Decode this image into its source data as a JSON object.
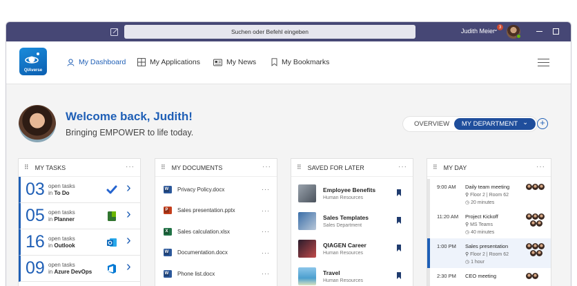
{
  "titlebar": {
    "search_placeholder": "Suchen oder Befehl eingeben",
    "user_name": "Judith Meier",
    "notification_count": "3",
    "caret": "⌄"
  },
  "nav": {
    "logo_text": "QIAverse",
    "items": [
      {
        "label": "My Dashboard",
        "icon": "person-icon",
        "active": true
      },
      {
        "label": "My Applications",
        "icon": "apps-grid-icon",
        "active": false
      },
      {
        "label": "My News",
        "icon": "news-icon",
        "active": false
      },
      {
        "label": "My Bookmarks",
        "icon": "bookmark-icon",
        "active": false
      }
    ]
  },
  "welcome": {
    "title": "Welcome back, Judith!",
    "subtitle": "Bringing EMPOWER to life today."
  },
  "view_switch": {
    "overview": "OVERVIEW",
    "department": "MY DEPARTMENT",
    "department_caret": "⌄",
    "plus": "+"
  },
  "tasks": {
    "title": "MY TASKS",
    "menu": "···",
    "prefix": "open tasks",
    "rows": [
      {
        "count": "03",
        "in": "in",
        "app": "To Do",
        "icon": "todo-check-icon",
        "color": "#2564cf"
      },
      {
        "count": "05",
        "in": "in",
        "app": "Planner",
        "icon": "planner-icon",
        "color": "#31752f"
      },
      {
        "count": "16",
        "in": "in",
        "app": "Outlook",
        "icon": "outlook-icon",
        "color": "#0f6cbd"
      },
      {
        "count": "09",
        "in": "in",
        "app": "Azure DevOps",
        "icon": "azure-devops-icon",
        "color": "#0078d4"
      }
    ]
  },
  "documents": {
    "title": "MY DOCUMENTS",
    "menu": "···",
    "rows": [
      {
        "name": "Privacy Policy.docx",
        "type": "word",
        "letter": "W",
        "color": "#2b579a"
      },
      {
        "name": "Sales presentation.pptx",
        "type": "powerpoint",
        "letter": "P",
        "color": "#c43e1c"
      },
      {
        "name": "Sales calculation.xlsx",
        "type": "excel",
        "letter": "X",
        "color": "#217346"
      },
      {
        "name": "Documentation.docx",
        "type": "word",
        "letter": "W",
        "color": "#2b579a"
      },
      {
        "name": "Phone list.docx",
        "type": "word",
        "letter": "W",
        "color": "#2b579a"
      }
    ],
    "row_menu": "···"
  },
  "saved": {
    "title": "SAVED FOR LATER",
    "menu": "···",
    "rows": [
      {
        "title": "Employee Benefits",
        "sub": "Human Resources",
        "thumb": "linear-gradient(135deg,#9aa3ad,#4a525c)"
      },
      {
        "title": "Sales Templates",
        "sub": "Sales Department",
        "thumb": "linear-gradient(135deg,#3a6ea8,#b8c7d8)"
      },
      {
        "title": "QIAGEN Career",
        "sub": "Human Resources",
        "thumb": "linear-gradient(135deg,#2a1c2c,#c04a4a)"
      },
      {
        "title": "Travel",
        "sub": "Human Resources",
        "thumb": "linear-gradient(180deg,#8cc6ea,#4c9fcf 60%,#d8e3c0)"
      }
    ]
  },
  "day": {
    "title": "MY DAY",
    "menu": "···",
    "events": [
      {
        "time": "9:00 AM",
        "title": "Daily team meeting",
        "location": "Floor 2 | Room 62",
        "duration": "20 minutes",
        "highlight": false
      },
      {
        "time": "11:20 AM",
        "title": "Project Kickoff",
        "location": "MS Teams",
        "duration": "40 minutes",
        "highlight": false
      },
      {
        "time": "1:00 PM",
        "title": "Sales presentation",
        "location": "Floor 2 | Room 62",
        "duration": "1 hour",
        "highlight": true
      },
      {
        "time": "2:30 PM",
        "title": "CEO meeting",
        "location": "",
        "duration": "",
        "highlight": false
      }
    ]
  }
}
